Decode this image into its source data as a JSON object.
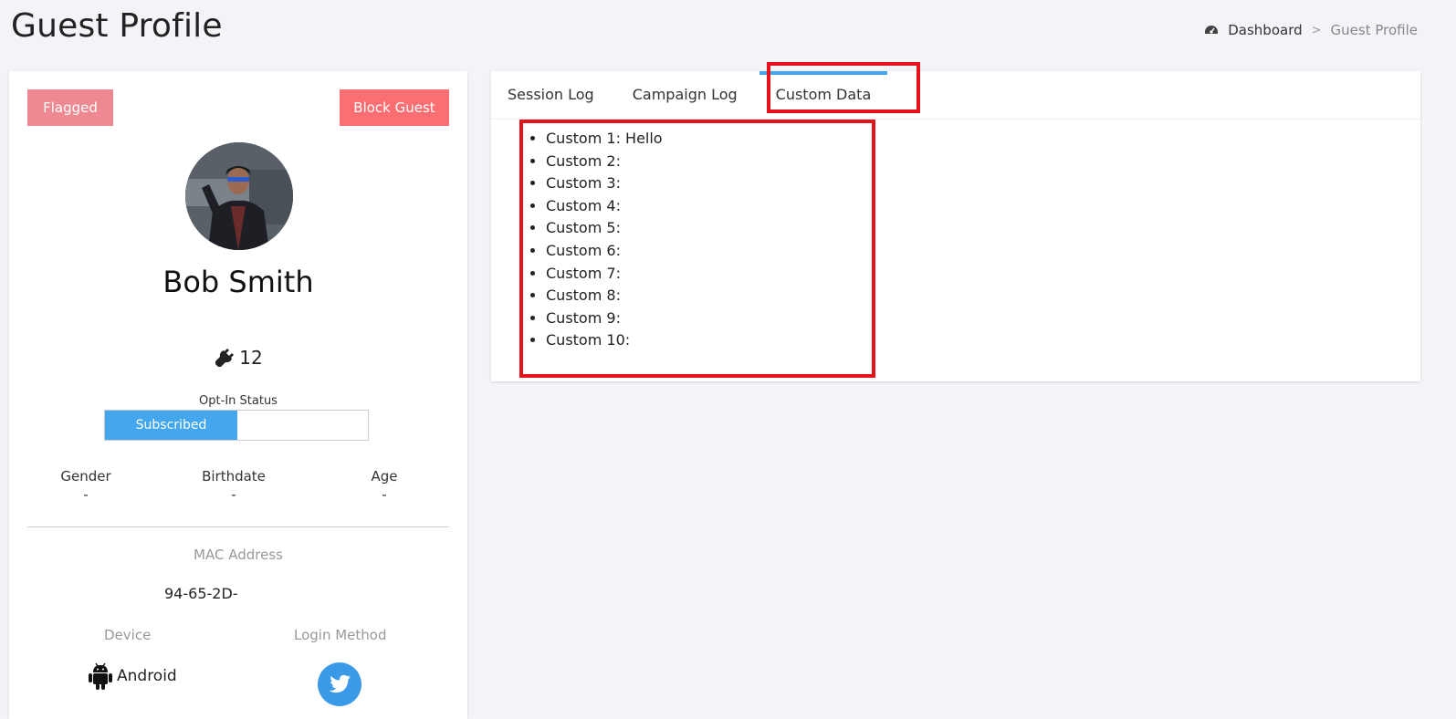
{
  "header": {
    "title": "Guest Profile",
    "breadcrumb": {
      "home": "Dashboard",
      "separator": ">",
      "current": "Guest Profile"
    }
  },
  "profile": {
    "flagged_label": "Flagged",
    "block_label": "Block Guest",
    "name": "Bob Smith",
    "session_count": "12",
    "optin": {
      "label": "Opt-In Status",
      "value": "Subscribed"
    },
    "demographics": {
      "gender_label": "Gender",
      "gender_value": "-",
      "birthdate_label": "Birthdate",
      "birthdate_value": "-",
      "age_label": "Age",
      "age_value": "-"
    },
    "mac_label": "MAC Address",
    "mac_value": "94-65-2D-",
    "device_label": "Device",
    "device_value": "Android",
    "login_label": "Login Method",
    "login_method_icon": "twitter-icon"
  },
  "tabs": [
    {
      "label": "Session Log",
      "active": false
    },
    {
      "label": "Campaign Log",
      "active": false
    },
    {
      "label": "Custom Data",
      "active": true
    }
  ],
  "custom_data": [
    "Custom 1: Hello",
    "Custom 2:",
    "Custom 3:",
    "Custom 4:",
    "Custom 5:",
    "Custom 6:",
    "Custom 7:",
    "Custom 8:",
    "Custom 9:",
    "Custom 10:"
  ],
  "colors": {
    "accent": "#44a6ec",
    "flagged": "#ee8991",
    "block": "#fb6f72",
    "highlight": "#e5141c",
    "twitter": "#3b9ae8"
  }
}
